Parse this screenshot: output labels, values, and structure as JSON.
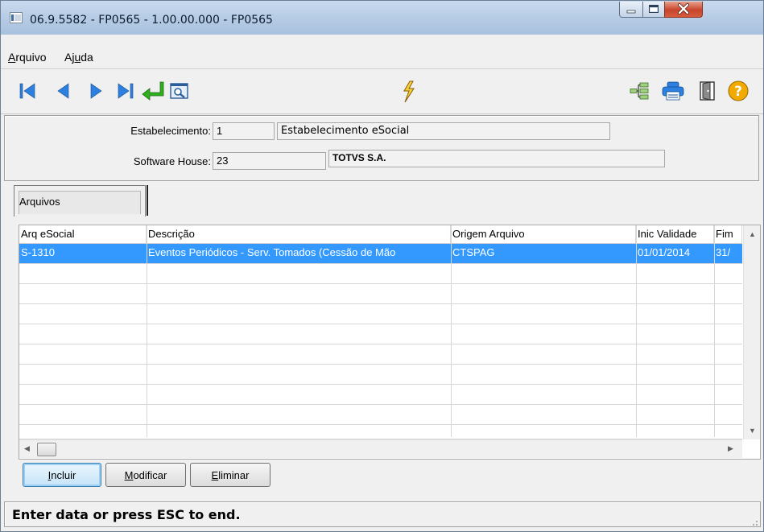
{
  "window": {
    "title": "06.9.5582 - FP0565 - 1.00.00.000 - FP0565"
  },
  "menu": [
    {
      "pre": "",
      "ul": "A",
      "post": "rquivo"
    },
    {
      "pre": "Aj",
      "ul": "u",
      "post": "da"
    }
  ],
  "header": {
    "estab_label": "Estabelecimento:",
    "estab_code": "1",
    "estab_desc": "Estabelecimento eSocial",
    "sw_label": "Software House:",
    "sw_code": "23",
    "sw_desc": "TOTVS S.A."
  },
  "tabs": [
    {
      "label": "Arquivos"
    }
  ],
  "grid": {
    "columns": [
      "Arq eSocial",
      "Descrição",
      "Origem Arquivo",
      "Inic Validade",
      "Fim"
    ],
    "rows": [
      [
        "S-1310",
        "Eventos Periódicos - Serv. Tomados (Cessão de Mão",
        "CTSPAG",
        "01/01/2014",
        "31/"
      ]
    ]
  },
  "buttons": [
    {
      "pre": "",
      "ul": "I",
      "post": "ncluir"
    },
    {
      "pre": "",
      "ul": "M",
      "post": "odificar"
    },
    {
      "pre": "",
      "ul": "E",
      "post": "liminar"
    }
  ],
  "status": {
    "text": "Enter data or press ESC to end."
  },
  "colors": {
    "selection": "#3399ff",
    "nav_arrow": "#2d7fe0",
    "enter_arrow": "#2fae1f",
    "help": "#f2a900"
  }
}
